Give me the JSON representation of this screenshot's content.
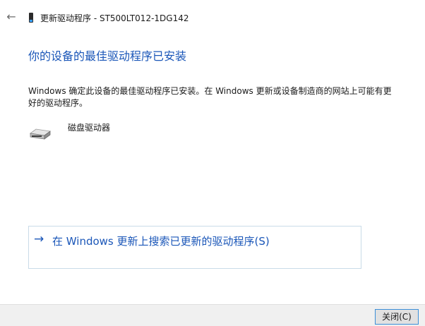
{
  "titlebar": {
    "back_icon": "arrow-left-icon",
    "device_icon": "phone-device-icon",
    "title": "更新驱动程序 - ST500LT012-1DG142"
  },
  "main": {
    "heading": "你的设备的最佳驱动程序已安装",
    "description": "Windows 确定此设备的最佳驱动程序已安装。在 Windows 更新或设备制造商的网站上可能有更好的驱动程序。",
    "device": {
      "icon": "disk-drive-icon",
      "label": "磁盘驱动器"
    },
    "search_option": {
      "icon": "arrow-right-icon",
      "label": "在 Windows 更新上搜索已更新的驱动程序(S)"
    }
  },
  "footer": {
    "close_label": "关闭(C)"
  },
  "colors": {
    "accent": "#1a56b8",
    "footer_bg": "#f0f0f0",
    "focus_border": "#3c8fd8"
  }
}
